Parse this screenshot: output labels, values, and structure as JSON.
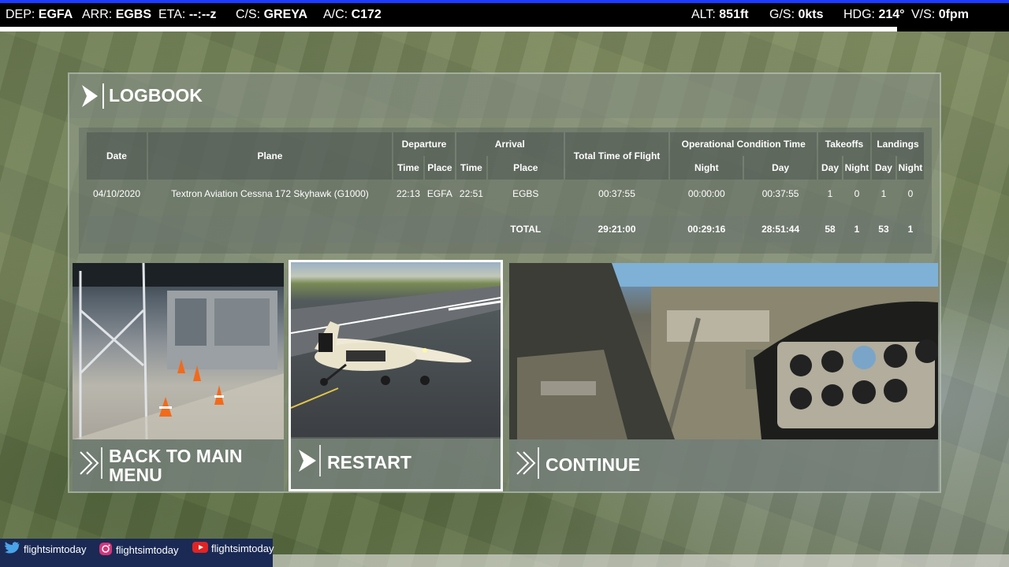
{
  "hud": {
    "dep_label": "DEP:",
    "dep": "EGFA",
    "arr_label": "ARR:",
    "arr": "EGBS",
    "eta_label": "ETA:",
    "eta": "--:--z",
    "cs_label": "C/S:",
    "cs": "GREYA",
    "ac_label": "A/C:",
    "ac": "C172",
    "alt_label": "ALT:",
    "alt": "851ft",
    "gs_label": "G/S:",
    "gs": "0kts",
    "hdg_label": "HDG:",
    "hdg": "214°",
    "vs_label": "V/S:",
    "vs": "0fpm"
  },
  "logbook": {
    "title": "LOGBOOK",
    "headers": {
      "date": "Date",
      "plane": "Plane",
      "departure": "Departure",
      "arrival": "Arrival",
      "total_time": "Total Time of Flight",
      "op_cond": "Operational Condition Time",
      "takeoffs": "Takeoffs",
      "landings": "Landings",
      "time": "Time",
      "place": "Place",
      "night": "Night",
      "day": "Day"
    },
    "row": {
      "date": "04/10/2020",
      "plane": "Textron Aviation Cessna 172 Skyhawk (G1000)",
      "dep_time": "22:13",
      "dep_place": "EGFA",
      "arr_time": "22:51",
      "arr_place": "EGBS",
      "total_time": "00:37:55",
      "night": "00:00:00",
      "day": "00:37:55",
      "takeoffs_day": "1",
      "takeoffs_night": "0",
      "landings_day": "1",
      "landings_night": "0"
    },
    "total": {
      "label": "TOTAL",
      "total_time": "29:21:00",
      "night": "00:29:16",
      "day": "28:51:44",
      "takeoffs_day": "58",
      "takeoffs_night": "1",
      "landings_day": "53",
      "landings_night": "1"
    }
  },
  "cards": {
    "main_menu": "BACK TO MAIN MENU",
    "main_menu_l1": "BACK TO MAIN",
    "main_menu_l2": "MENU",
    "restart": "RESTART",
    "continue": "CONTINUE"
  },
  "social": {
    "twitter": "flightsimtoday",
    "instagram": "flightsimtoday",
    "youtube": "flightsimtoday"
  },
  "colors": {
    "hud_bg": "#000000",
    "hud_accent": "#1e3cff",
    "social_bg": "#1a2a55",
    "selected_border": "#ffffff"
  }
}
